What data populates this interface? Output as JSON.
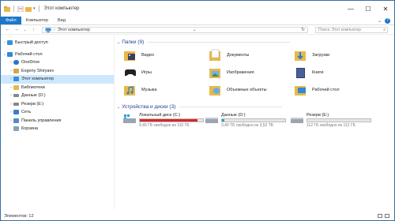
{
  "window": {
    "title": "Этот компьютер"
  },
  "ribbon": {
    "tabs": [
      {
        "label": "Файл"
      },
      {
        "label": "Компьютер"
      },
      {
        "label": "Вид"
      }
    ]
  },
  "address": {
    "path_root": "Этот компьютер",
    "search_placeholder": "Поиск: Этот компьютер"
  },
  "navpane": {
    "items": [
      {
        "label": "Быстрый доступ",
        "icon": "star-icon",
        "color": "#3b8fd9"
      },
      {
        "label": "Рабочий стол",
        "icon": "desktop-icon",
        "color": "#2f88d8"
      },
      {
        "label": "OneDrive",
        "icon": "cloud-icon",
        "color": "#2a74c8"
      },
      {
        "label": "Evgeny Shiryaev",
        "icon": "user-icon",
        "color": "#d9a441"
      },
      {
        "label": "Этот компьютер",
        "icon": "computer-icon",
        "color": "#3c8ed8"
      },
      {
        "label": "Библиотеки",
        "icon": "library-icon",
        "color": "#e5b84c"
      },
      {
        "label": "Данные (D:)",
        "icon": "drive-icon",
        "color": "#888888"
      },
      {
        "label": "Резерв (E:)",
        "icon": "drive-icon",
        "color": "#888888"
      },
      {
        "label": "Сеть",
        "icon": "network-icon",
        "color": "#3a7ec9"
      },
      {
        "label": "Панель управления",
        "icon": "control-panel-icon",
        "color": "#4e8cc9"
      },
      {
        "label": "Корзина",
        "icon": "recycle-bin-icon",
        "color": "#8aa0b6"
      }
    ]
  },
  "folders": {
    "header": "Папки",
    "count": "(9)",
    "items": [
      {
        "label": "Видео",
        "icon": "videos-folder-icon"
      },
      {
        "label": "Документы",
        "icon": "documents-folder-icon"
      },
      {
        "label": "Загрузки",
        "icon": "downloads-folder-icon"
      },
      {
        "label": "Игры",
        "icon": "games-folder-icon"
      },
      {
        "label": "Изображения",
        "icon": "pictures-folder-icon"
      },
      {
        "label": "Книги",
        "icon": "books-folder-icon"
      },
      {
        "label": "Музыка",
        "icon": "music-folder-icon"
      },
      {
        "label": "Объемные объекты",
        "icon": "3d-objects-folder-icon"
      },
      {
        "label": "Рабочий стол",
        "icon": "desktop-folder-icon"
      }
    ]
  },
  "devices": {
    "header": "Устройства и диски",
    "count": "(3)",
    "drives": [
      {
        "name": "Локальный диск (C:)",
        "free": "9,45 ГБ свободно из 110 ГБ",
        "used_fraction": 0.914,
        "bar_color": "#da2626",
        "icon": "windows-drive-icon"
      },
      {
        "name": "Данные (D:)",
        "free": "3,40 ТБ свободно из 3,52 ТБ",
        "used_fraction": 0.034,
        "bar_color": "#26a0da",
        "icon": "hard-drive-icon"
      },
      {
        "name": "Резерв (E:)",
        "free": "112 ГБ свободно из 112 ГБ",
        "used_fraction": 0.0,
        "bar_color": "#26a0da",
        "icon": "hard-drive-icon"
      }
    ]
  },
  "status": {
    "items_count": "Элементов: 12"
  }
}
